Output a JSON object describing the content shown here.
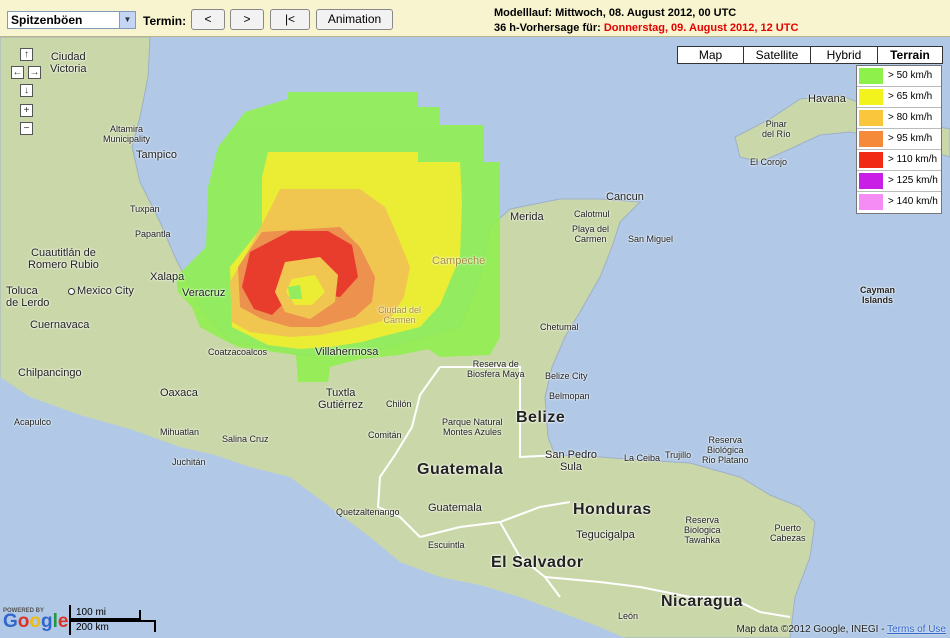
{
  "toolbar": {
    "parameter_select": "Spitzenböen",
    "termin_label": "Termin:",
    "btn_prev": "<",
    "btn_next": ">",
    "btn_first": "|<",
    "btn_animation": "Animation",
    "run_text": "Modelllauf: Mittwoch, 08. August 2012, 00 UTC",
    "forecast_prefix": "36 h-Vorhersage für: ",
    "forecast_date": "Donnerstag, 09. August 2012, 12 UTC"
  },
  "nav": {
    "up": "↑",
    "left": "←",
    "right": "→",
    "down": "↓",
    "zoom_in": "+",
    "zoom_out": "−"
  },
  "map_types": [
    {
      "label": "Map",
      "active": false
    },
    {
      "label": "Satellite",
      "active": false
    },
    {
      "label": "Hybrid",
      "active": false
    },
    {
      "label": "Terrain",
      "active": true
    }
  ],
  "legend": [
    {
      "label": "> 50 km/h",
      "color": "#8ef04a"
    },
    {
      "label": "> 65 km/h",
      "color": "#f2f21c"
    },
    {
      "label": "> 80 km/h",
      "color": "#fac63c"
    },
    {
      "label": "> 95 km/h",
      "color": "#f58a3a"
    },
    {
      "label": "> 110 km/h",
      "color": "#f02a14"
    },
    {
      "label": "> 125 km/h",
      "color": "#c81ee6"
    },
    {
      "label": "> 140 km/h",
      "color": "#f58cf5"
    }
  ],
  "labels": {
    "ciudad_victoria": "Ciudad\nVictoria",
    "altamira": "Altamira\nMunicipality",
    "tampico": "Tampico",
    "tuxpan": "Tuxpan",
    "papantla": "Papantla",
    "cuautitlan": "Cuautitlán de\nRomero Rubio",
    "xalapa": "Xalapa",
    "veracruz": "Veracruz",
    "toluca": "Toluca\nde Lerdo",
    "mexico_city": "Mexico City",
    "cuernavaca": "Cuernavaca",
    "chilpancingo": "Chilpancingo",
    "oaxaca": "Oaxaca",
    "acapulco": "Acapulco",
    "mihuatlan": "Mihuatlan",
    "salina_cruz": "Salina Cruz",
    "juchitan": "Juchitán",
    "coatzacoalcos": "Coatzacoalcos",
    "villahermosa": "Villahermosa",
    "ciudad_carmen": "Ciudad del\nCarmen",
    "campeche": "Campeche",
    "tuxtla": "Tuxtla\nGutiérrez",
    "chilon": "Chilón",
    "comitan": "Comitán",
    "merida": "Merida",
    "cancun": "Cancun",
    "calotmul": "Calotmul",
    "playa": "Playa del\nCarmen",
    "san_miguel": "San Miguel",
    "chetumal": "Chetumal",
    "reserva_maya": "Reserva de\nBiosfera Maya",
    "belize_city": "Belize City",
    "belmopan": "Belmopan",
    "belize": "Belize",
    "parque": "Parque Natural\nMontes Azules",
    "guatemala_country": "Guatemala",
    "guatemala_city": "Guatemala",
    "quetzaltenango": "Quetzaltenango",
    "escuintla": "Escuintla",
    "san_pedro_sula": "San Pedro\nSula",
    "la_ceiba": "La Ceiba",
    "trujillo": "Trujillo",
    "rio_platano": "Reserva\nBiológica\nRio Platano",
    "honduras": "Honduras",
    "tegucigalpa": "Tegucigalpa",
    "tawahka": "Reserva\nBiologica\nTawahka",
    "puerto": "Puerto\nCabezas",
    "el_salvador": "El Salvador",
    "nicaragua": "Nicaragua",
    "leon": "León",
    "havana": "Havana",
    "pinar": "Pinar\ndel Río",
    "el_corojo": "El Corojo",
    "cayman": "Cayman\nIslands"
  },
  "footer": {
    "powered": "POWERED BY",
    "google": "Google",
    "scale_mi": "100 mi",
    "scale_km": "200 km",
    "attribution": "Map data ©2012 Google, INEGI - ",
    "terms": "Terms of Use"
  }
}
